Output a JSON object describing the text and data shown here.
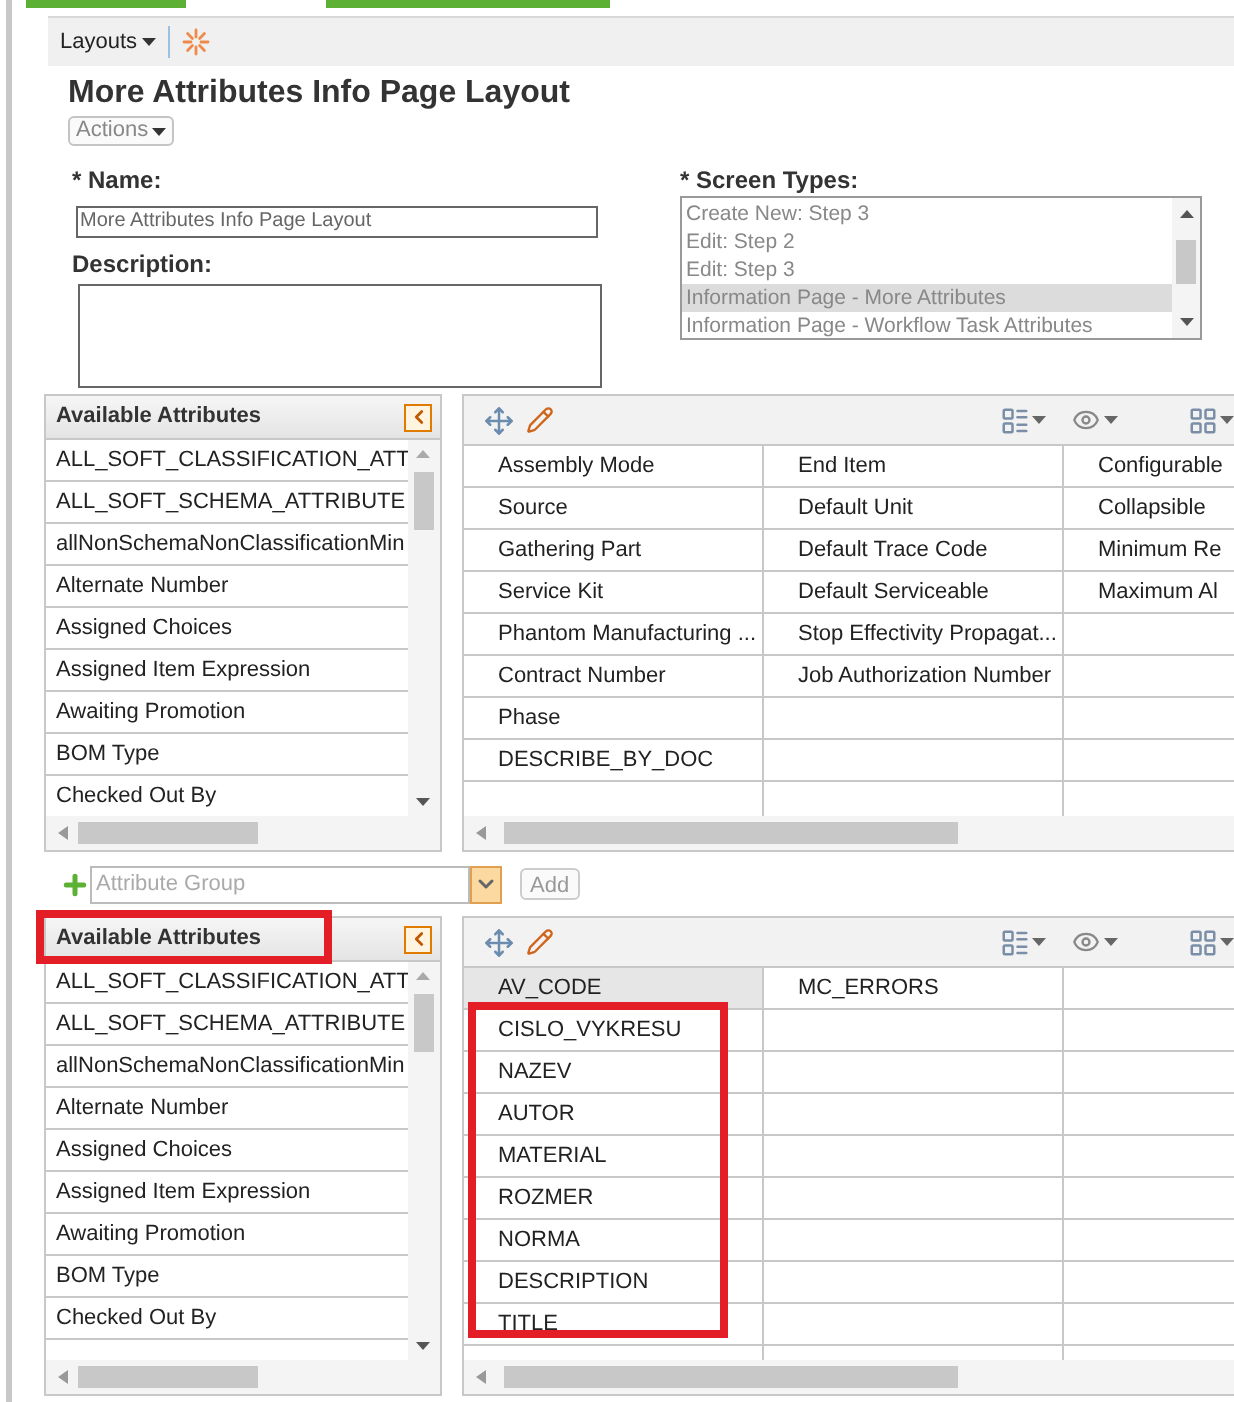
{
  "toolbar": {
    "menu": "Layouts"
  },
  "title": "More Attributes Info Page Layout",
  "actions_button": "Actions",
  "name_field": {
    "label": "* Name:",
    "value": "More Attributes Info Page Layout"
  },
  "description_field": {
    "label": "Description:"
  },
  "screen_types": {
    "label": "* Screen Types:",
    "options": [
      {
        "label": "Create New: Step 3",
        "selected": false
      },
      {
        "label": "Edit: Step 2",
        "selected": false
      },
      {
        "label": "Edit: Step 3",
        "selected": false
      },
      {
        "label": "Information Page - More Attributes",
        "selected": true
      },
      {
        "label": "Information Page - Workflow Task Attributes",
        "selected": false
      }
    ]
  },
  "sections": [
    {
      "available_attributes": {
        "title": "Available Attributes",
        "items": [
          "ALL_SOFT_CLASSIFICATION_ATT",
          "ALL_SOFT_SCHEMA_ATTRIBUTE",
          "allNonSchemaNonClassificationMin",
          "Alternate Number",
          "Assigned Choices",
          "Assigned Item Expression",
          "Awaiting Promotion",
          "BOM Type",
          "Checked Out By"
        ]
      },
      "grid": {
        "rows": [
          [
            {
              "text": "Assembly Mode",
              "selected": false
            },
            {
              "text": "End Item",
              "selected": false
            },
            {
              "text": "Configurable",
              "selected": false
            }
          ],
          [
            {
              "text": "Source",
              "selected": false
            },
            {
              "text": "Default Unit",
              "selected": false
            },
            {
              "text": "Collapsible",
              "selected": false
            }
          ],
          [
            {
              "text": "Gathering Part",
              "selected": false
            },
            {
              "text": "Default Trace Code",
              "selected": false
            },
            {
              "text": "Minimum Re",
              "selected": false
            }
          ],
          [
            {
              "text": "Service Kit",
              "selected": false
            },
            {
              "text": "Default Serviceable",
              "selected": false
            },
            {
              "text": "Maximum Al",
              "selected": false
            }
          ],
          [
            {
              "text": "Phantom Manufacturing ...",
              "selected": false
            },
            {
              "text": "Stop Effectivity Propagat...",
              "selected": false
            }
          ],
          [
            {
              "text": "Contract Number",
              "selected": false
            },
            {
              "text": "Job Authorization Number",
              "selected": false
            }
          ],
          [
            {
              "text": "Phase",
              "selected": false
            }
          ],
          [
            {
              "text": "DESCRIBE_BY_DOC",
              "selected": false
            }
          ],
          []
        ]
      },
      "highlights": {
        "title": false,
        "first_column": false
      }
    },
    {
      "available_attributes": {
        "title": "Available Attributes",
        "items": [
          "ALL_SOFT_CLASSIFICATION_ATT",
          "ALL_SOFT_SCHEMA_ATTRIBUTE",
          "allNonSchemaNonClassificationMin",
          "Alternate Number",
          "Assigned Choices",
          "Assigned Item Expression",
          "Awaiting Promotion",
          "BOM Type",
          "Checked Out By"
        ]
      },
      "grid": {
        "rows": [
          [
            {
              "text": "AV_CODE",
              "selected": true
            },
            {
              "text": "MC_ERRORS",
              "selected": false
            }
          ],
          [
            {
              "text": "CISLO_VYKRESU",
              "selected": false
            }
          ],
          [
            {
              "text": "NAZEV",
              "selected": false
            }
          ],
          [
            {
              "text": "AUTOR",
              "selected": false
            }
          ],
          [
            {
              "text": "MATERIAL",
              "selected": false
            }
          ],
          [
            {
              "text": "ROZMER",
              "selected": false
            }
          ],
          [
            {
              "text": "NORMA",
              "selected": false
            }
          ],
          [
            {
              "text": "DESCRIPTION",
              "selected": false
            }
          ],
          [
            {
              "text": "TITLE",
              "selected": false
            }
          ]
        ]
      },
      "highlights": {
        "title": true,
        "first_column": true
      }
    }
  ],
  "attribute_group": {
    "placeholder": "Attribute Group",
    "add_button": "Add"
  }
}
